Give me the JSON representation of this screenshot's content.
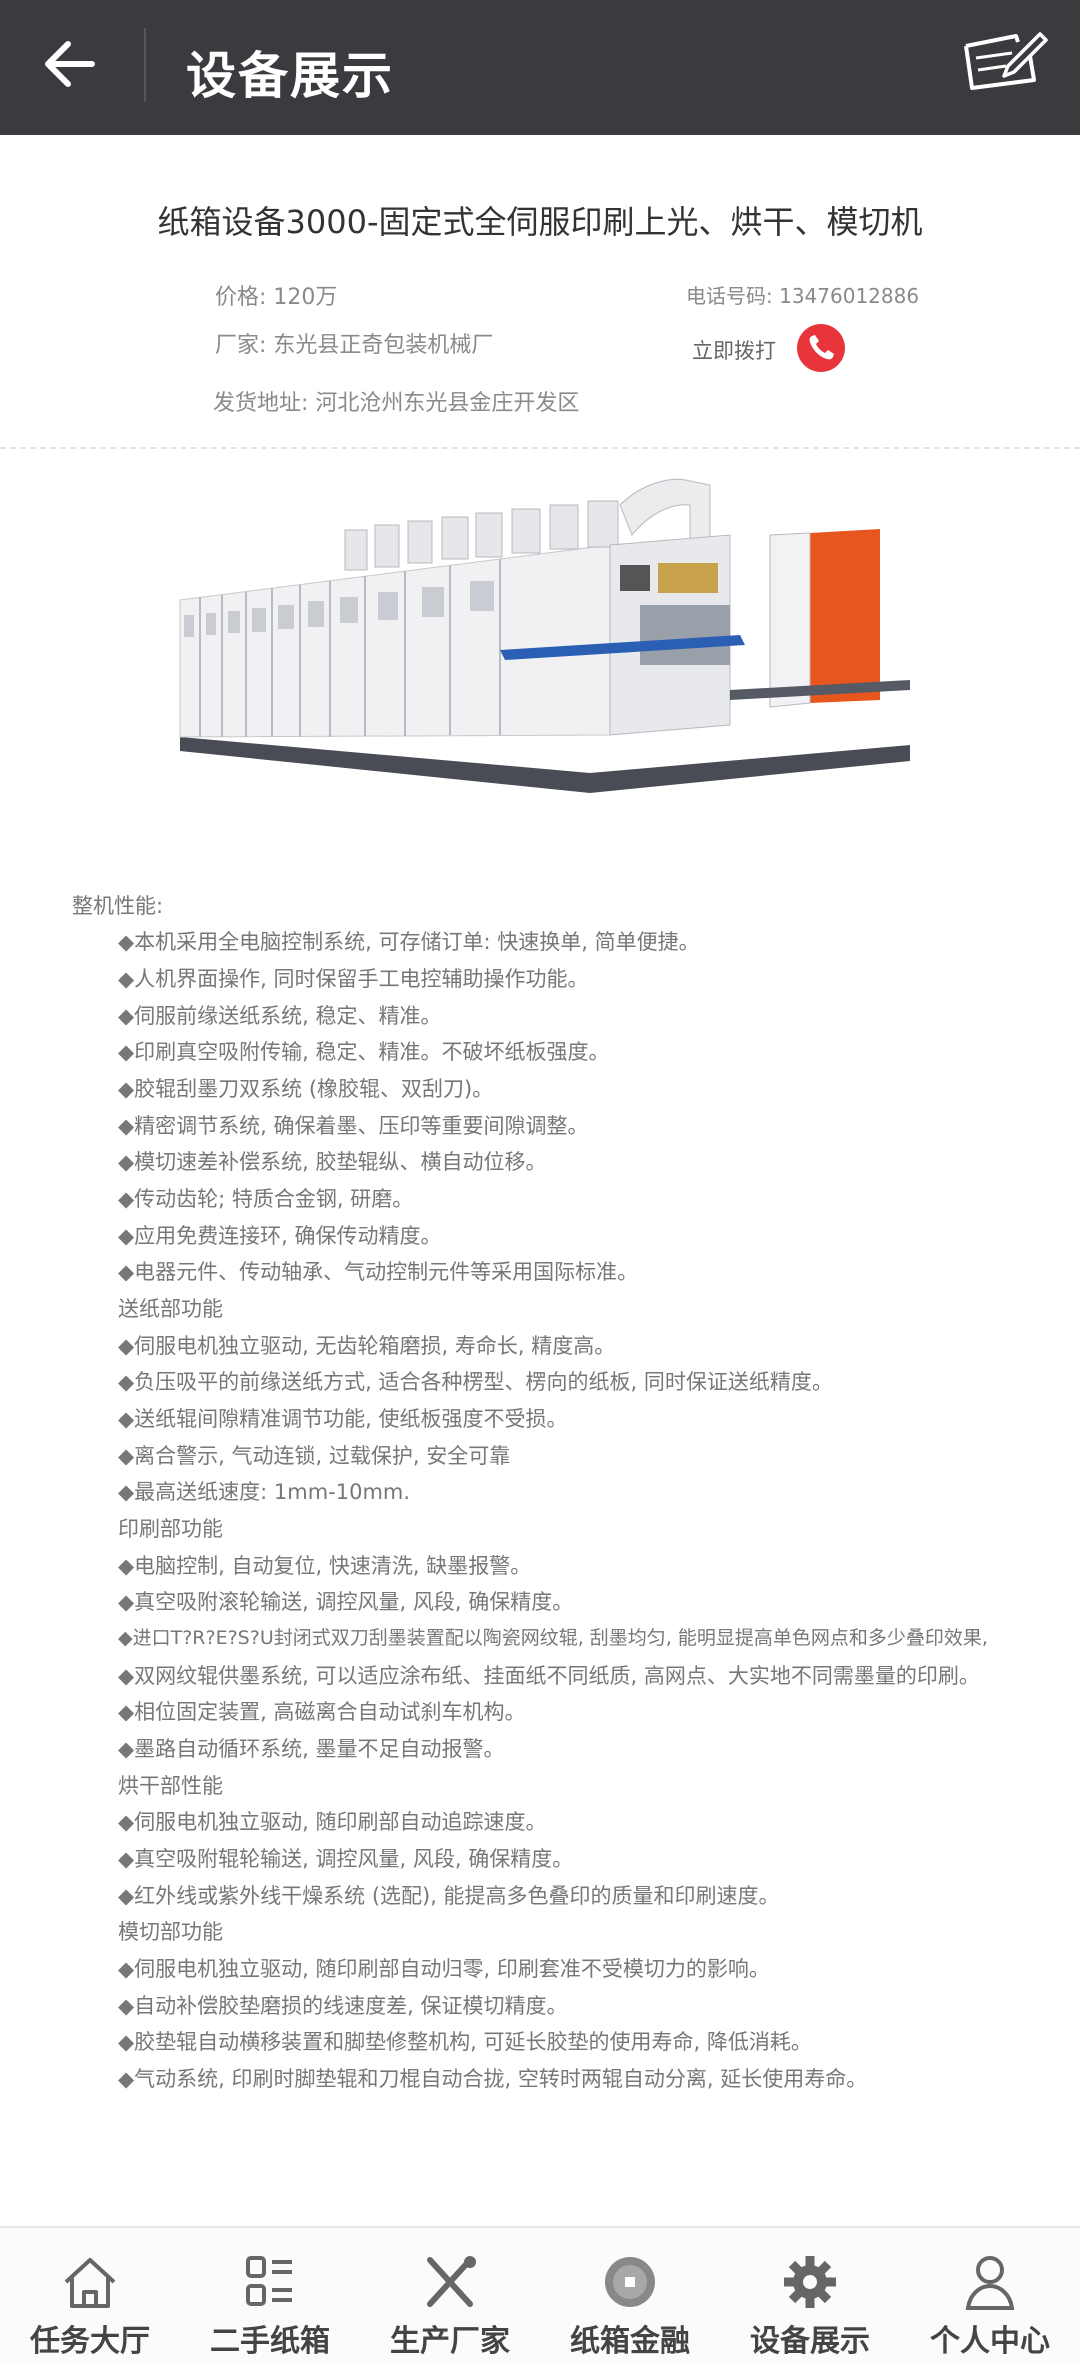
{
  "header": {
    "title": "设备展示"
  },
  "product": {
    "title": "纸箱设备3000-固定式全伺服印刷上光、烘干、模切机",
    "price": "价格: 120万",
    "manufacturer": "厂家: 东光县正奇包装机械厂",
    "address": "发货地址: 河北沧州东光县金庄开发区",
    "phone": "电话号码: 13476012886",
    "call_label": "立即拨打"
  },
  "specs": [
    "整机性能:",
    "◆本机采用全电脑控制系统, 可存储订单: 快速换单, 简单便捷。",
    "◆人机界面操作, 同时保留手工电控辅助操作功能。",
    "◆伺服前缘送纸系统, 稳定、精准。",
    "◆印刷真空吸附传输, 稳定、精准。不破坏纸板强度。",
    "◆胶辊刮墨刀双系统 (橡胶辊、双刮刀)。",
    "◆精密调节系统, 确保着墨、压印等重要间隙调整。",
    "◆模切速差补偿系统, 胶垫辊纵、横自动位移。",
    "◆传动齿轮; 特质合金钢, 研磨。",
    "◆应用免费连接环, 确保传动精度。",
    "◆电器元件、传动轴承、气动控制元件等采用国际标准。",
    "送纸部功能",
    "◆伺服电机独立驱动, 无齿轮箱磨损, 寿命长, 精度高。",
    "◆负压吸平的前缘送纸方式, 适合各种楞型、楞向的纸板, 同时保证送纸精度。",
    "◆送纸辊间隙精准调节功能, 使纸板强度不受损。",
    "◆离合警示, 气动连锁, 过载保护, 安全可靠",
    "◆最高送纸速度: 1mm-10mm.",
    "印刷部功能",
    "◆电脑控制, 自动复位, 快速清洗, 缺墨报警。",
    "◆真空吸附滚轮输送, 调控风量, 风段, 确保精度。",
    "◆进口T?R?E?S?U封闭式双刀刮墨装置配以陶瓷网纹辊, 刮墨均匀, 能明显提高单色网点和多少叠印效果,",
    "◆双网纹辊供墨系统, 可以适应涂布纸、挂面纸不同纸质, 高网点、大实地不同需墨量的印刷。",
    "◆相位固定装置, 高磁离合自动试刹车机构。",
    "◆墨路自动循环系统, 墨量不足自动报警。",
    "烘干部性能",
    "◆伺服电机独立驱动, 随印刷部自动追踪速度。",
    "◆真空吸附辊轮输送, 调控风量, 风段, 确保精度。",
    "◆红外线或紫外线干燥系统 (选配), 能提高多色叠印的质量和印刷速度。",
    "模切部功能",
    "◆伺服电机独立驱动, 随印刷部自动归零, 印刷套准不受模切力的影响。",
    "◆自动补偿胶垫磨损的线速度差, 保证模切精度。",
    "◆胶垫辊自动横移装置和脚垫修整机构, 可延长胶垫的使用寿命, 降低消耗。",
    "◆气动系统, 印刷时脚垫辊和刀棍自动合拢, 空转时两辊自动分离, 延长使用寿命。"
  ],
  "tabs": [
    {
      "label": "任务大厅",
      "icon": "home-icon"
    },
    {
      "label": "二手纸箱",
      "icon": "list-icon"
    },
    {
      "label": "生产厂家",
      "icon": "tools-icon"
    },
    {
      "label": "纸箱金融",
      "icon": "coin-icon"
    },
    {
      "label": "设备展示",
      "icon": "gear-icon"
    },
    {
      "label": "个人中心",
      "icon": "user-icon"
    }
  ],
  "colors": {
    "header_bg": "#3a3b3f",
    "call_red": "#e8353b",
    "machine_orange": "#e8561f"
  }
}
